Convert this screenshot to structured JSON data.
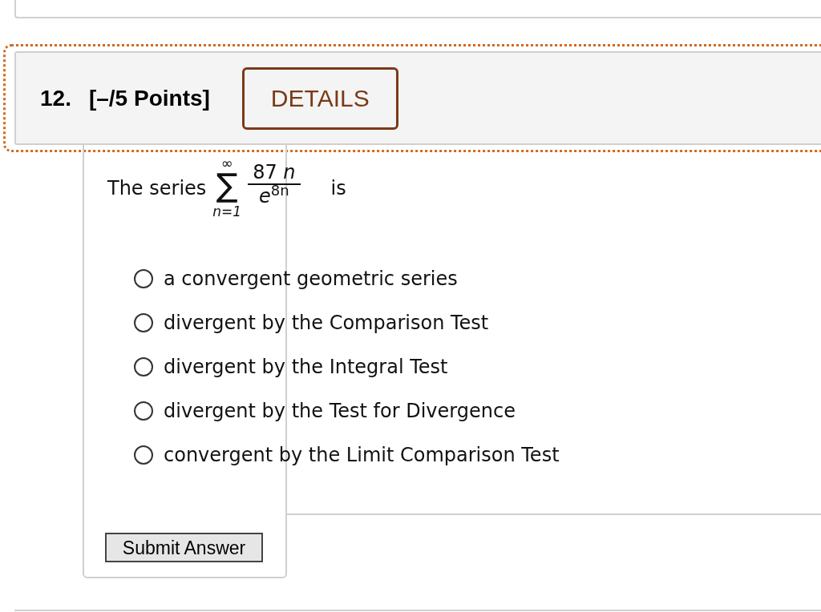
{
  "question": {
    "number": "12.",
    "points": "[–/5 Points]",
    "details_button": "DETAILS"
  },
  "prompt": {
    "lead": "The series",
    "sum_sign": "∑",
    "upper_limit": "∞",
    "lower_limit": "n=1",
    "numerator": "87 *n*",
    "denominator": "*e*$^{8n}$",
    "tail": "is"
  },
  "options": [
    {
      "label": "a convergent geometric series",
      "selected": false
    },
    {
      "label": "divergent by the Comparison Test",
      "selected": false
    },
    {
      "label": "divergent by the Integral Test",
      "selected": false
    },
    {
      "label": "divergent by the Test for Divergence",
      "selected": false
    },
    {
      "label": "convergent by the Limit Comparison Test",
      "selected": false
    }
  ],
  "submit_button": "Submit Answer"
}
